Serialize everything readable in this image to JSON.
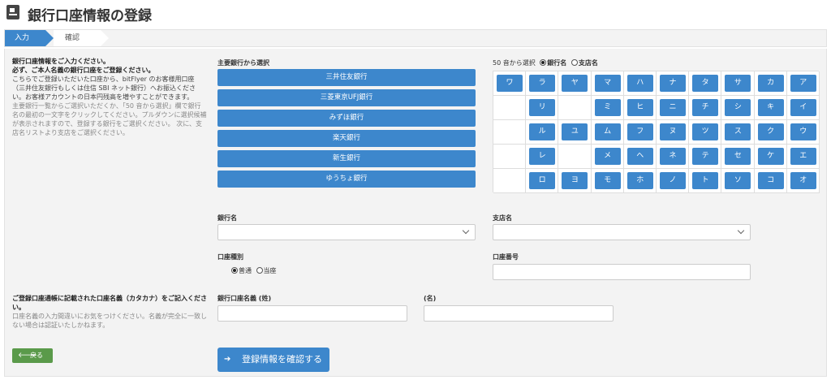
{
  "header": {
    "title": "銀行口座情報の登録"
  },
  "steps": [
    "入力",
    "確認"
  ],
  "intro": {
    "line1": "銀行口座情報をご入力ください。",
    "line2": "必ず、ご本人名義の銀行口座をご登録ください。",
    "line3": "こちらでご登録いただいた口座から、bitFlyer のお客様用口座（三井住友銀行もしくは住信 SBI ネット銀行）へお振込ください。お客様アカウントの日本円残高を増やすことができます。",
    "line4": "主要銀行一覧からご選択いただくか、「50 音から選択」欄で銀行名の最初の一文字をクリックしてください。プルダウンに選択候補が表示されますので、登録する銀行をご選択ください。 次に、支店名リストより支店をご選択ください。"
  },
  "major_banks": {
    "label": "主要銀行から選択",
    "items": [
      "三井住友銀行",
      "三菱東京UFJ銀行",
      "みずほ銀行",
      "楽天銀行",
      "新生銀行",
      "ゆうちょ銀行"
    ]
  },
  "kana": {
    "prefix": "50 音から選択",
    "opt_bank": "銀行名",
    "opt_branch": "支店名",
    "rows": [
      [
        "ワ",
        "ラ",
        "ヤ",
        "マ",
        "ハ",
        "ナ",
        "タ",
        "サ",
        "カ",
        "ア"
      ],
      [
        "",
        "リ",
        "",
        "ミ",
        "ヒ",
        "ニ",
        "チ",
        "シ",
        "キ",
        "イ"
      ],
      [
        "",
        "ル",
        "ユ",
        "ム",
        "フ",
        "ヌ",
        "ツ",
        "ス",
        "ク",
        "ウ"
      ],
      [
        "",
        "レ",
        "",
        "メ",
        "ヘ",
        "ネ",
        "テ",
        "セ",
        "ケ",
        "エ"
      ],
      [
        "",
        "ロ",
        "ヨ",
        "モ",
        "ホ",
        "ノ",
        "ト",
        "ソ",
        "コ",
        "オ"
      ]
    ]
  },
  "form": {
    "bank_label": "銀行名",
    "branch_label": "支店名",
    "account_type_label": "口座種別",
    "account_type_options": [
      "普通",
      "当座"
    ],
    "account_number_label": "口座番号",
    "holder_last_label": "銀行口座名義 (姓)",
    "holder_first_label": "(名)"
  },
  "note": {
    "line1": "ご登録口座通帳に記載された口座名義（カタカナ）をご記入ください。",
    "line2": "口座名義の入力間違いにお気をつけください。名義が完全に一致しない場合は認証いたしかねます。"
  },
  "buttons": {
    "back": "戻る",
    "confirm": "登録情報を確認する"
  },
  "colors": {
    "primary": "#3d87cc",
    "back": "#5a9a4a"
  }
}
